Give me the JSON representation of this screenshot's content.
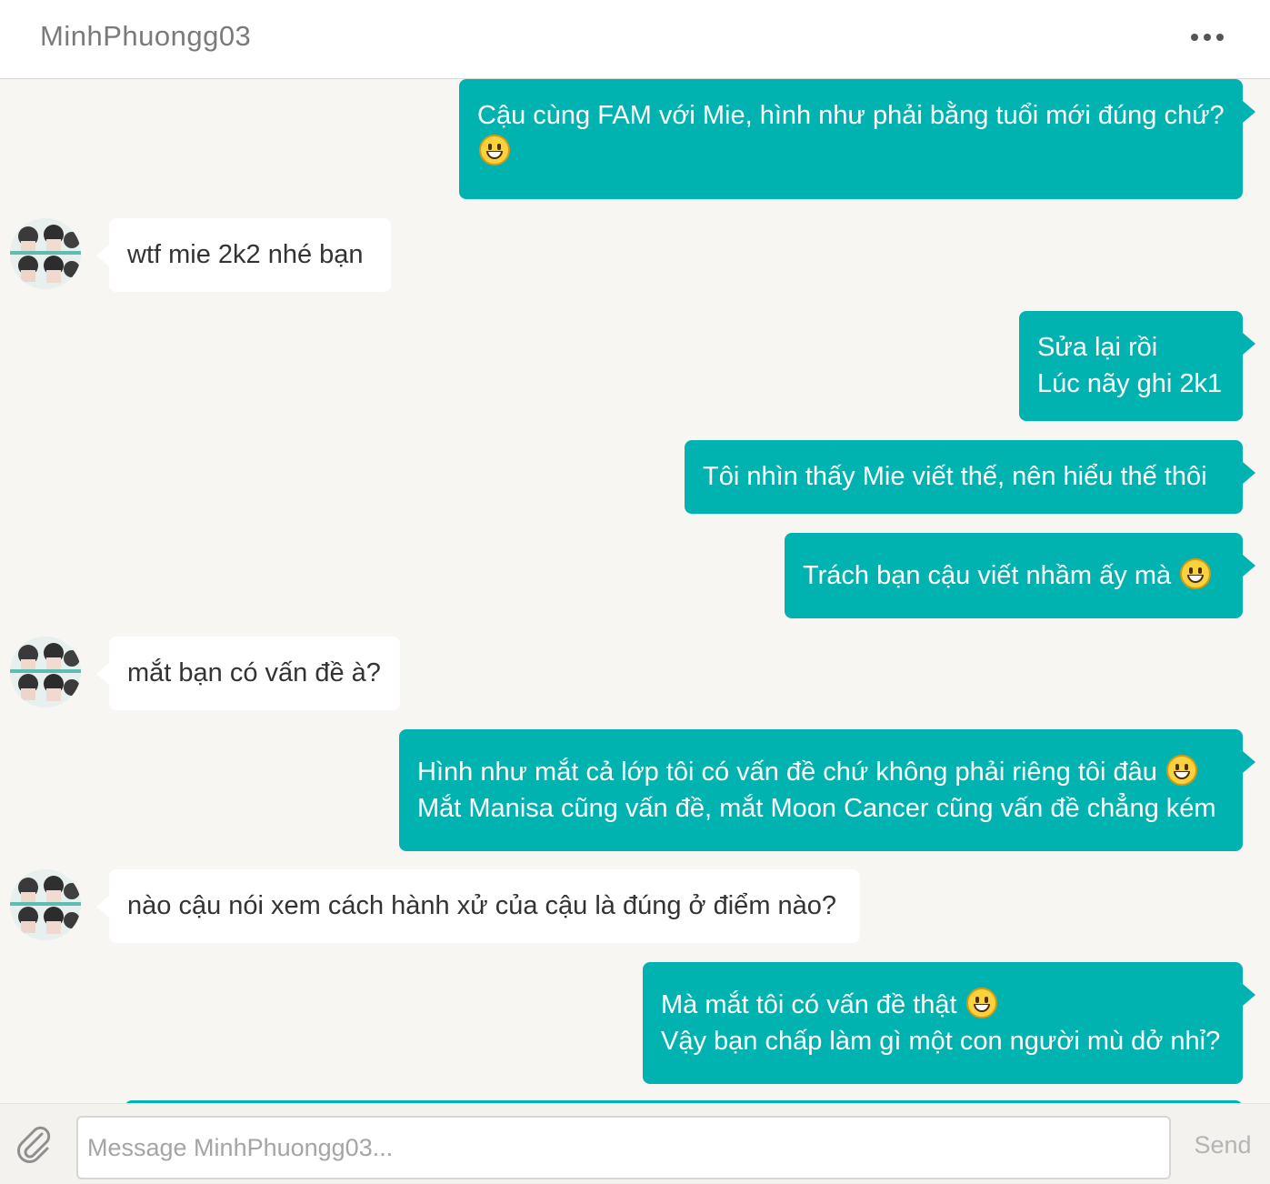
{
  "header": {
    "title": "MinhPhuongg03",
    "menu_icon": "more-horizontal-icon"
  },
  "messages": [
    {
      "side": "out",
      "lines": [
        {
          "text": "Cậu cùng FAM với Mie, hình như phải bằng tuổi mới đúng chứ?",
          "emoji": false
        },
        {
          "text": "",
          "emoji": true
        }
      ]
    },
    {
      "side": "in",
      "lines": [
        {
          "text": "wtf mie 2k2 nhé bạn",
          "emoji": false
        }
      ]
    },
    {
      "side": "out",
      "lines": [
        {
          "text": "Sửa lại rồi",
          "emoji": false
        },
        {
          "text": "Lúc nãy ghi 2k1",
          "emoji": false
        }
      ]
    },
    {
      "side": "out",
      "lines": [
        {
          "text": "Tôi nhìn thấy Mie viết thế, nên hiểu thế thôi",
          "emoji": false
        }
      ]
    },
    {
      "side": "out",
      "lines": [
        {
          "text": "Trách bạn cậu viết nhầm ấy mà",
          "emoji": true
        }
      ]
    },
    {
      "side": "in",
      "lines": [
        {
          "text": "mắt bạn có vấn đề à?",
          "emoji": false
        }
      ]
    },
    {
      "side": "out",
      "lines": [
        {
          "text": "Hình như mắt cả lớp tôi có vấn đề chứ không phải riêng tôi đâu",
          "emoji": true
        },
        {
          "text": "Mắt Manisa cũng vấn đề, mắt Moon Cancer cũng vấn đề chẳng kém",
          "emoji": false
        }
      ]
    },
    {
      "side": "in",
      "lines": [
        {
          "text": "nào cậu nói xem cách hành xử của cậu là đúng ở điểm nào?",
          "emoji": false
        }
      ]
    },
    {
      "side": "out",
      "lines": [
        {
          "text": "Mà mắt tôi có vấn đề thật",
          "emoji": true
        },
        {
          "text": "Vậy bạn chấp làm gì một con người mù dở nhỉ?",
          "emoji": false
        }
      ]
    }
  ],
  "composer": {
    "placeholder": "Message MinhPhuongg03...",
    "send_label": "Send",
    "attach_icon": "paperclip-icon"
  },
  "colors": {
    "outgoing_bubble": "#00b2b0",
    "incoming_bubble": "#ffffff",
    "background": "#f7f6f2"
  }
}
